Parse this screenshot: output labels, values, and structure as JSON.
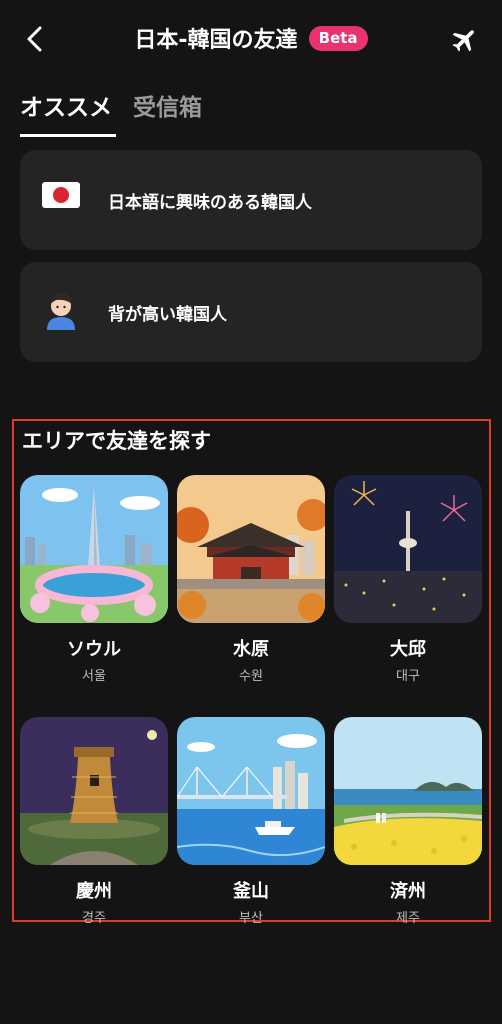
{
  "header": {
    "title": "日本-韓国の友達",
    "badge": "Beta",
    "back_icon": "chevron-left-icon",
    "plane_icon": "airplane-icon"
  },
  "tabs": [
    {
      "label": "オススメ",
      "active": true
    },
    {
      "label": "受信箱",
      "active": false
    }
  ],
  "recommend_cards": [
    {
      "label": "日本語に興味のある韓国人",
      "icon": "japan-flag-icon"
    },
    {
      "label": "背が高い韓国人",
      "icon": "person-avatar-icon"
    }
  ],
  "area_section": {
    "title": "エリアで友達を探す",
    "cities": [
      {
        "jp": "ソウル",
        "ko": "서울"
      },
      {
        "jp": "水原",
        "ko": "수원"
      },
      {
        "jp": "大邱",
        "ko": "대구"
      },
      {
        "jp": "慶州",
        "ko": "경주"
      },
      {
        "jp": "釜山",
        "ko": "부산"
      },
      {
        "jp": "済州",
        "ko": "제주"
      }
    ]
  },
  "colors": {
    "background": "#141414",
    "card": "#242424",
    "badge": "#e8336f",
    "highlight_border": "#e03a2a"
  }
}
